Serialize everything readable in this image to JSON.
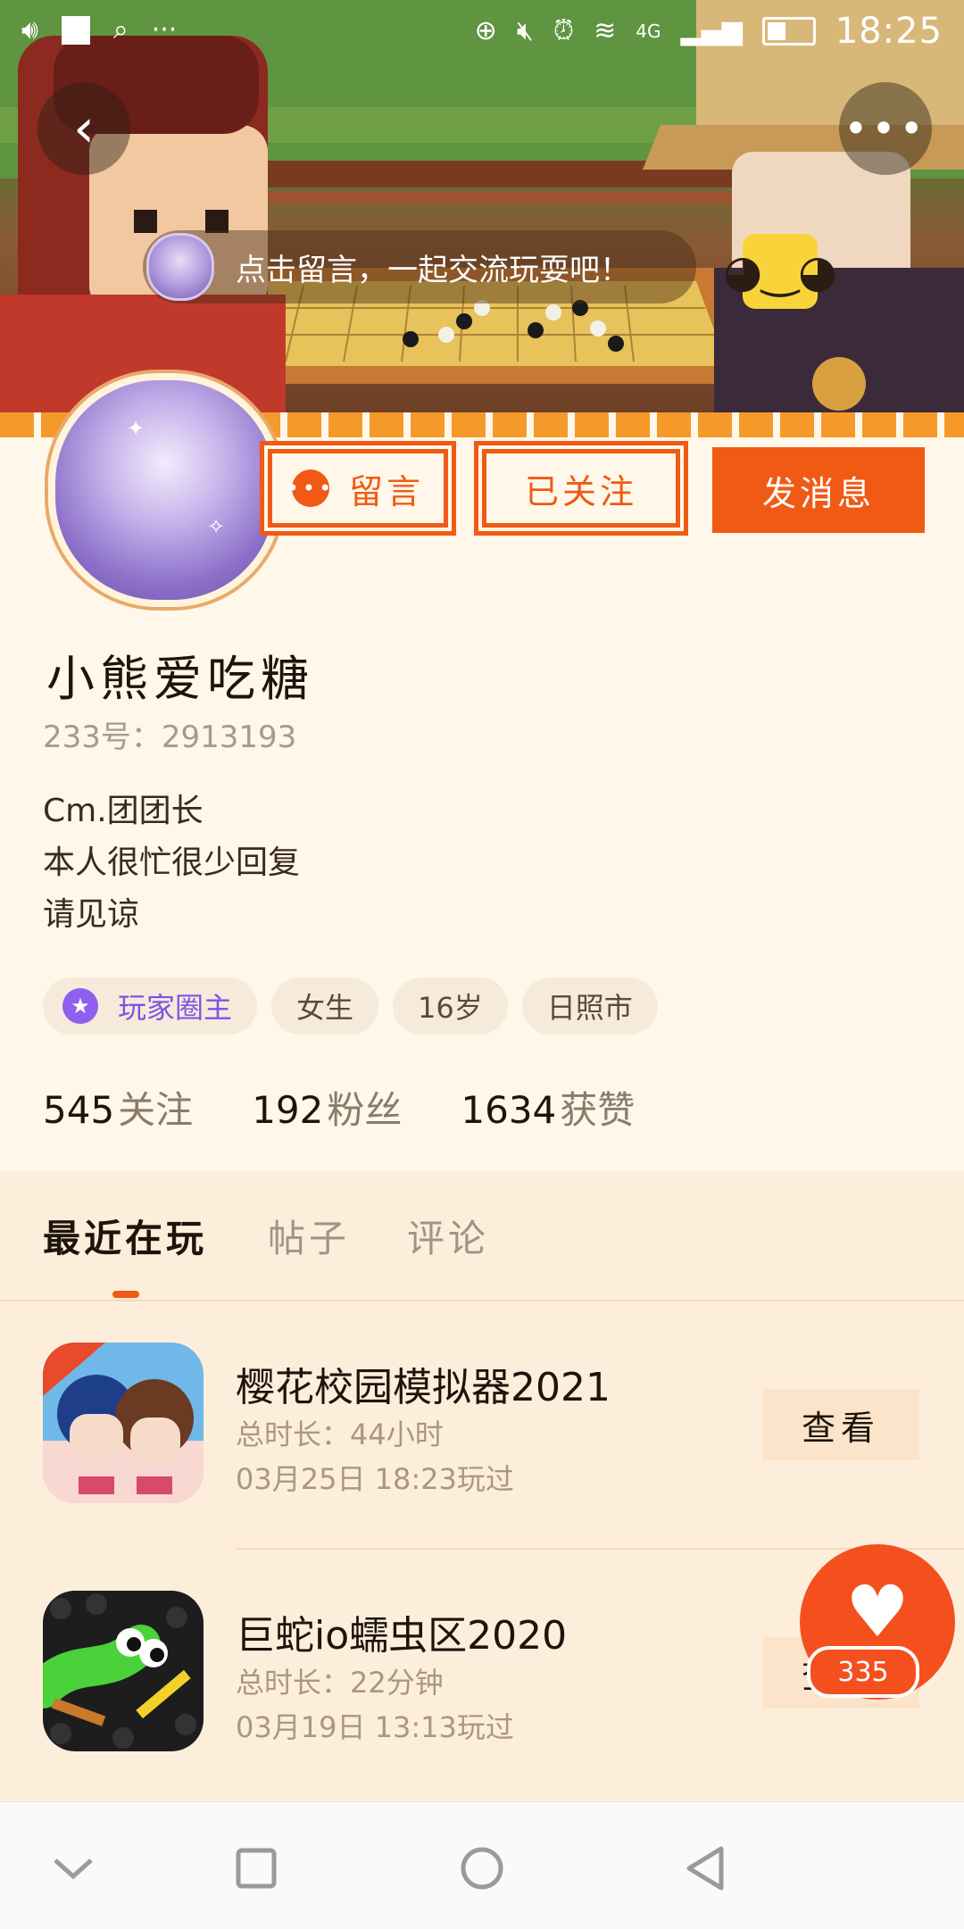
{
  "status_bar": {
    "time": "18:25",
    "network": "4G",
    "left_icons": [
      "volume-icon",
      "square-icon",
      "search-icon",
      "more-dots-icon"
    ],
    "right_icons": [
      "data-saver-icon",
      "mute-icon",
      "alarm-icon",
      "wifi-icon",
      "signal-icon",
      "battery-icon"
    ]
  },
  "header": {
    "message_prompt": "点击留言，一起交流玩耍吧！"
  },
  "actions": {
    "message_label": "留言",
    "follow_label": "已关注",
    "send_label": "发消息"
  },
  "profile": {
    "username": "小熊爱吃糖",
    "uid": "233号：2913193",
    "bio": [
      "Cm.团团长",
      "本人很忙很少回复",
      "请见谅"
    ],
    "tags": [
      "玩家圈主",
      "女生",
      "16岁",
      "日照市"
    ],
    "stats": [
      {
        "num": "545",
        "label": "关注"
      },
      {
        "num": "192",
        "label": "粉丝"
      },
      {
        "num": "1634",
        "label": "获赞"
      }
    ]
  },
  "tabs": [
    "最近在玩",
    "帖子",
    "评论"
  ],
  "games": [
    {
      "title": "樱花校园模拟器2021",
      "duration": "总时长：44小时",
      "last_played": "03月25日 18:23玩过",
      "action": "查看"
    },
    {
      "title": "巨蛇io蠕虫区2020",
      "duration": "总时长：22分钟",
      "last_played": "03月19日 13:13玩过",
      "action": "查看"
    }
  ],
  "like": {
    "count": "335"
  },
  "colors": {
    "accent": "#f05a14",
    "owner_purple": "#8d61ee",
    "background": "#fff6e8"
  }
}
